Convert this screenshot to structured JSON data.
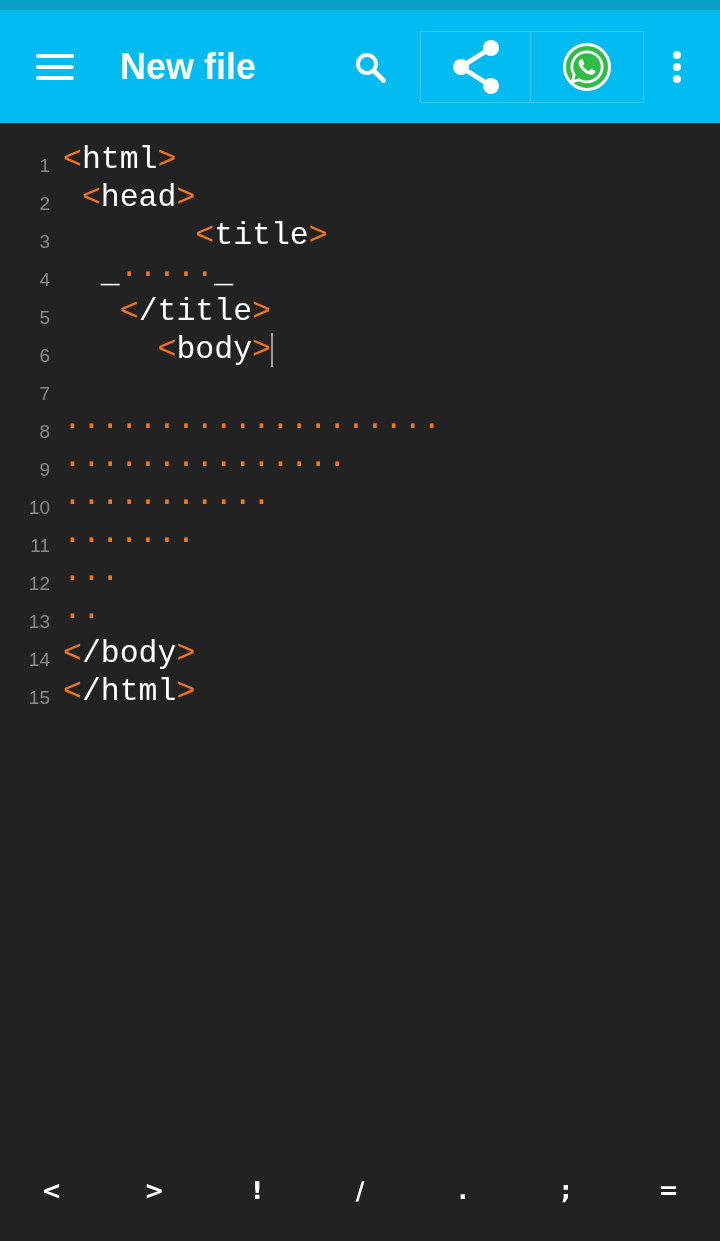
{
  "app_bar": {
    "title": "New file"
  },
  "editor": {
    "lines": [
      {
        "number": "1",
        "text": "<html>",
        "cursor": false
      },
      {
        "number": "2",
        "text": " <head>",
        "cursor": false
      },
      {
        "number": "3",
        "text": "       <title>",
        "cursor": false
      },
      {
        "number": "4",
        "text": "  _·····_",
        "cursor": false
      },
      {
        "number": "5",
        "text": "   </title>",
        "cursor": false
      },
      {
        "number": "6",
        "text": "     <body>",
        "cursor": true
      },
      {
        "number": "7",
        "cursor": false
      },
      {
        "number": "8",
        "text": "····················",
        "cursor": false
      },
      {
        "number": "9",
        "text": "···············",
        "cursor": false
      },
      {
        "number": "10",
        "text": "···········",
        "cursor": false
      },
      {
        "number": "11",
        "text": "·······",
        "cursor": false
      },
      {
        "number": "12",
        "text": "···",
        "cursor": false
      },
      {
        "number": "13",
        "text": "··",
        "cursor": false
      },
      {
        "number": "14",
        "text": "</body>",
        "cursor": false
      },
      {
        "number": "15",
        "text": "</html>",
        "cursor": false
      }
    ]
  },
  "symbol_bar": [
    "<",
    ">",
    "!",
    "/",
    ".",
    ";",
    "="
  ]
}
